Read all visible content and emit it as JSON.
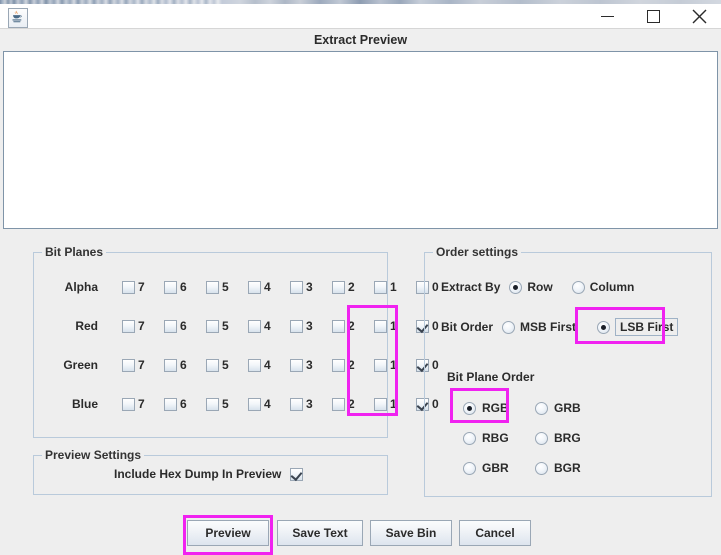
{
  "window": {
    "app_icon": "java-coffee-cup-icon",
    "controls": {
      "minimize": "minimize-icon",
      "maximize": "maximize-icon",
      "close": "close-icon"
    }
  },
  "preview": {
    "title": "Extract Preview",
    "text": ""
  },
  "bit_planes": {
    "legend": "Bit Planes",
    "bits": [
      "7",
      "6",
      "5",
      "4",
      "3",
      "2",
      "1",
      "0"
    ],
    "rows": [
      {
        "label": "Alpha",
        "checked": [
          false,
          false,
          false,
          false,
          false,
          false,
          false,
          false
        ]
      },
      {
        "label": "Red",
        "checked": [
          false,
          false,
          false,
          false,
          false,
          false,
          false,
          true
        ]
      },
      {
        "label": "Green",
        "checked": [
          false,
          false,
          false,
          false,
          false,
          false,
          false,
          true
        ]
      },
      {
        "label": "Blue",
        "checked": [
          false,
          false,
          false,
          false,
          false,
          false,
          false,
          true
        ]
      }
    ]
  },
  "preview_settings": {
    "legend": "Preview Settings",
    "include_hex_dump_label": "Include Hex Dump In Preview",
    "include_hex_dump_checked": true
  },
  "order_settings": {
    "legend": "Order settings",
    "extract_by": {
      "label": "Extract By",
      "options": [
        "Row",
        "Column"
      ],
      "selected": "Row"
    },
    "bit_order": {
      "label": "Bit Order",
      "options": [
        "MSB First",
        "LSB First"
      ],
      "selected": "LSB First"
    },
    "bit_plane_order": {
      "label": "Bit Plane Order",
      "options": [
        "RGB",
        "GRB",
        "RBG",
        "BRG",
        "GBR",
        "BGR"
      ],
      "selected": "RGB"
    }
  },
  "buttons": {
    "preview": "Preview",
    "save_text": "Save Text",
    "save_bin": "Save Bin",
    "cancel": "Cancel"
  },
  "annotations": {
    "highlight_color": "#f022f0",
    "regions": [
      "bitplane-lsb-column",
      "bit-order-lsb-first",
      "bit-plane-order-rgb",
      "preview-button"
    ]
  }
}
